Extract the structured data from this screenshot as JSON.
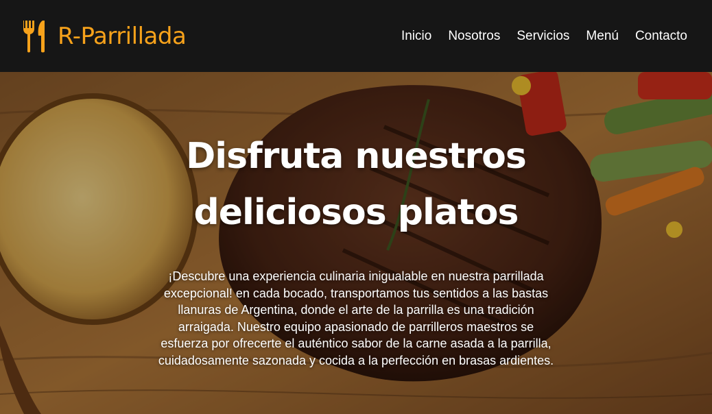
{
  "brand": {
    "logo_icon": "fork-and-knife-icon",
    "name": "R-Parrillada",
    "color": "#f7a21b"
  },
  "nav": {
    "items": [
      {
        "label": "Inicio"
      },
      {
        "label": "Nosotros"
      },
      {
        "label": "Servicios"
      },
      {
        "label": "Menú"
      },
      {
        "label": "Contacto"
      }
    ]
  },
  "hero": {
    "title": "Disfruta nuestros deliciosos platos",
    "description": "¡Descubre una experiencia culinaria inigualable en nuestra parrillada excepcional! en cada bocado, transportamos tus sentidos a las bastas llanuras de Argentina, donde el arte de la parrilla es una tradición arraigada. Nuestro equipo apasionado de parrilleros maestros se esfuerza por ofrecerte el auténtico sabor de la carne asada a la parrilla, cuidadosamente sazonada y cocida a la perfección en brasas ardientes."
  },
  "colors": {
    "header_bg": "#161616",
    "accent": "#f7a21b",
    "text": "#ffffff"
  }
}
